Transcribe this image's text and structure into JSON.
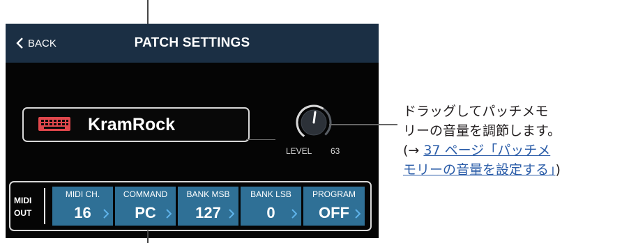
{
  "header": {
    "back_label": "BACK",
    "title": "PATCH SETTINGS"
  },
  "patch": {
    "name": "KramRock",
    "icon": "keyboard-icon",
    "icon_color": "#e0474c"
  },
  "level": {
    "label": "LEVEL",
    "value": "63",
    "fraction": 0.63
  },
  "midi": {
    "out_label_line1": "MIDI",
    "out_label_line2": "OUT",
    "params": [
      {
        "label": "MIDI CH.",
        "value": "16"
      },
      {
        "label": "COMMAND",
        "value": "PC"
      },
      {
        "label": "BANK MSB",
        "value": "127"
      },
      {
        "label": "BANK LSB",
        "value": "0"
      },
      {
        "label": "PROGRAM",
        "value": "OFF"
      }
    ]
  },
  "annotation": {
    "line1": "ドラッグしてパッチメモ",
    "line2": "リーの音量を調節します。",
    "line3_prefix": "(→ ",
    "line3_link": "37 ページ「パッチメ",
    "line4_link": "モリーの音量を設定する」",
    "line4_suffix": ")"
  },
  "colors": {
    "header_bg": "#1b2f44",
    "param_bg": "#2f7096",
    "chevron": "#5fb3ea",
    "screen_bg": "#050505"
  }
}
